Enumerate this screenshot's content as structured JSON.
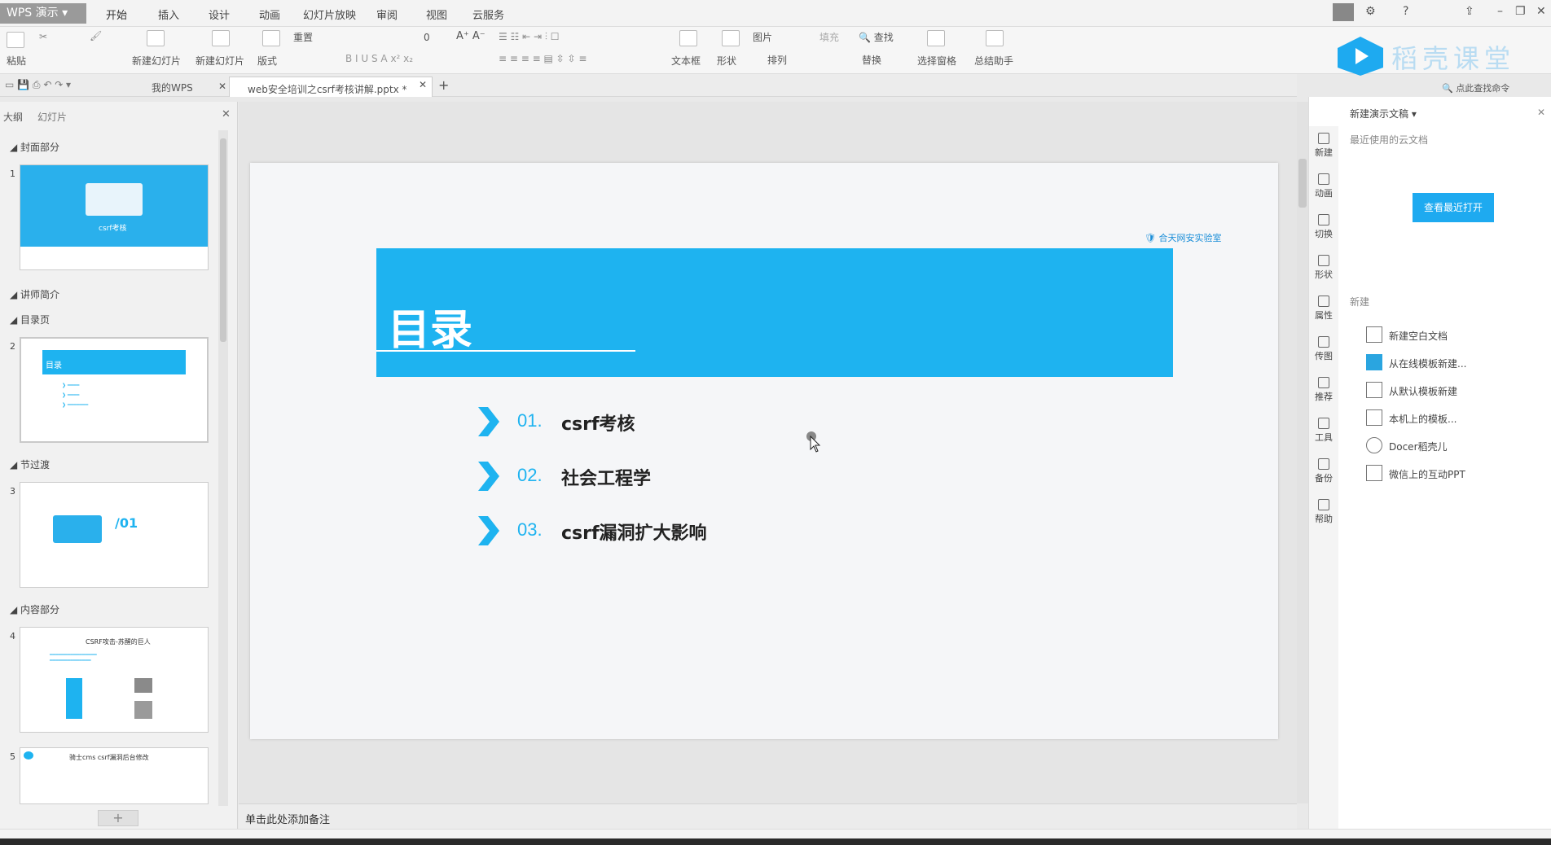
{
  "app": {
    "name": "WPS 演示"
  },
  "menu": [
    "开始",
    "插入",
    "设计",
    "动画",
    "幻灯片放映",
    "审阅",
    "视图",
    "云服务"
  ],
  "ribbon": {
    "paste": "粘贴",
    "format_painter": "格式刷",
    "new_slide": "新建幻灯片",
    "layout": "版式",
    "reset": "重置",
    "font_size": "0",
    "textbox": "文本框",
    "shapes": "形状",
    "picture": "图片",
    "arrange": "排列",
    "fill": "填充",
    "find": "查找",
    "replace": "替换",
    "select_pane": "选择窗格",
    "summary_helper": "总结助手"
  },
  "docs_logo": "稻壳课堂",
  "tabs": {
    "mywps": "我的WPS",
    "file": "web安全培训之csrf考核讲解.pptx *"
  },
  "search_cmd": "点此查找命令",
  "left_pane": {
    "tab_outline": "大纲",
    "tab_slides": "幻灯片",
    "sections": [
      "封面部分",
      "讲师简介",
      "目录页",
      "节过渡",
      "内容部分"
    ],
    "thumbs": [
      {
        "num": "1",
        "title": "csrf考核"
      },
      {
        "num": "2",
        "title": "目录"
      },
      {
        "num": "3",
        "title": "/01"
      },
      {
        "num": "4",
        "title": "CSRF攻击-苏醒的巨人"
      },
      {
        "num": "5",
        "title": "骑士cms csrf漏洞后台修改"
      }
    ]
  },
  "slide": {
    "title": "目录",
    "logo_text": "合天网安实验室",
    "toc": [
      {
        "num": "01.",
        "text": "csrf考核"
      },
      {
        "num": "02.",
        "text": "社会工程学"
      },
      {
        "num": "03.",
        "text": "csrf漏洞扩大影响"
      }
    ]
  },
  "notes": "单击此处添加备注",
  "right_pane": {
    "header": "新建演示文稿",
    "recent_cloud": "最近使用的云文档",
    "open_recent": "查看最近打开",
    "new_section": "新建",
    "icons": [
      "新建",
      "动画",
      "切换",
      "形状",
      "属性",
      "传图",
      "推荐",
      "工具",
      "备份",
      "帮助"
    ],
    "new_items": [
      "新建空白文档",
      "从在线模板新建...",
      "从默认模板新建",
      "本机上的模板...",
      "Docer稻壳儿",
      "微信上的互动PPT"
    ]
  },
  "colors": {
    "accent": "#1eb3f0",
    "button": "#1eaaf0"
  }
}
